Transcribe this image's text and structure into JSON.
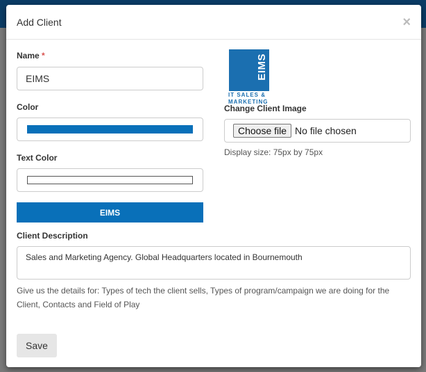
{
  "modal": {
    "title": "Add Client",
    "close_glyph": "×"
  },
  "form": {
    "name_label": "Name",
    "required_mark": "*",
    "name_value": "EIMS",
    "color_label": "Color",
    "color_value": "#0970b9",
    "text_color_label": "Text Color",
    "text_color_value": "#ffffff",
    "preview_label": "EIMS",
    "description_label": "Client Description",
    "description_value": "Sales and Marketing Agency. Global Headquarters located in Bournemouth",
    "description_help": "Give us the details for: Types of tech the client sells, Types of program/campaign we are doing for the Client, Contacts and Field of Play",
    "save_label": "Save"
  },
  "image": {
    "logo_text": "EIMS",
    "logo_sub_1": "IT SALES &",
    "logo_sub_2": "MARKETING",
    "change_label": "Change Client Image",
    "choose_file_label": "Choose file",
    "no_file_text": "No file chosen",
    "display_size_help": "Display size: 75px by 75px"
  },
  "colors": {
    "accent": "#0970b9",
    "logo_blue": "#1b6fb0",
    "required": "#d9534f"
  }
}
